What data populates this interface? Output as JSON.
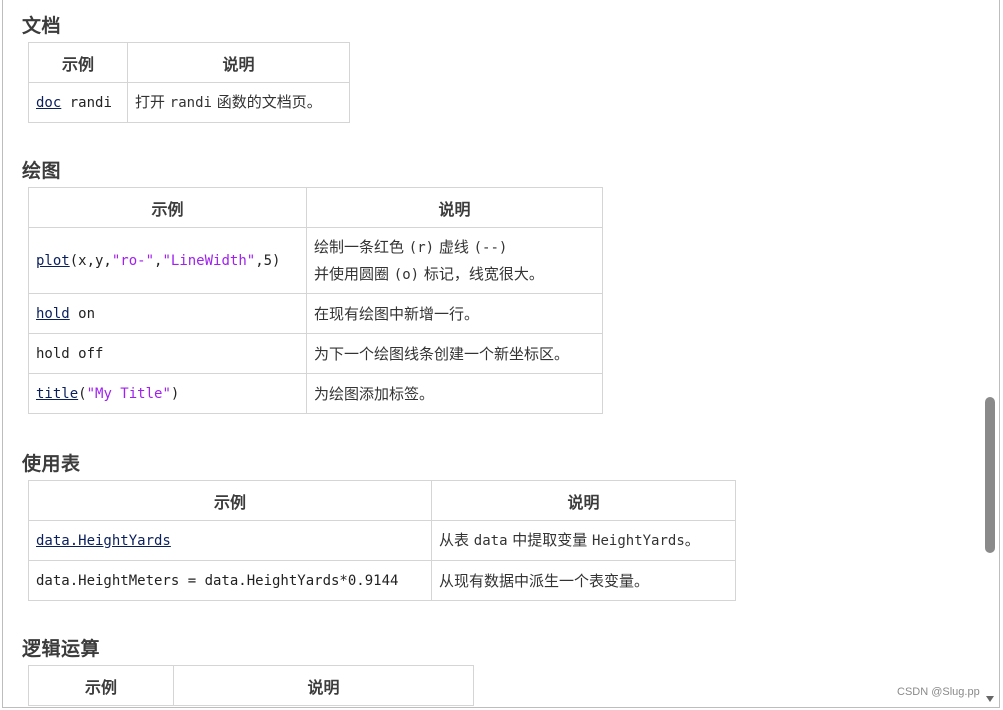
{
  "sections": {
    "doc": {
      "title": "文档",
      "headers": [
        "示例",
        "说明"
      ],
      "rows": [
        {
          "fn": "doc",
          "rest": " randi",
          "desc_pre": "打开 ",
          "desc_code": "randi",
          "desc_post": " 函数的文档页。"
        }
      ]
    },
    "plot": {
      "title": "绘图",
      "headers": [
        "示例",
        "说明"
      ],
      "row1": {
        "fn": "plot",
        "a": "(x,y,",
        "s1": "\"ro-\"",
        "b": ",",
        "s2": "\"LineWidth\"",
        "c": ",5)",
        "desc_line1_a": "绘制一条红色 ",
        "desc_line1_code": "(r)",
        "desc_line1_b": " 虚线 ",
        "desc_line1_code2": "(--)",
        "desc_line2_a": "并使用圆圈 ",
        "desc_line2_code": "(o)",
        "desc_line2_b": " 标记，线宽很大。"
      },
      "row2": {
        "fn": "hold",
        "rest": " on",
        "desc": "在现有绘图中新增一行。"
      },
      "row3": {
        "code": "hold off",
        "desc": "为下一个绘图线条创建一个新坐标区。"
      },
      "row4": {
        "fn": "title",
        "a": "(",
        "s": "\"My Title\"",
        "b": ")",
        "desc": "为绘图添加标签。"
      }
    },
    "table": {
      "title": "使用表",
      "headers": [
        "示例",
        "说明"
      ],
      "row1": {
        "fn": "data.HeightYards",
        "desc_a": "从表 ",
        "desc_code": "data",
        "desc_b": " 中提取变量 ",
        "desc_code2": "HeightYards",
        "desc_c": "。"
      },
      "row2": {
        "code": "data.HeightMeters = data.HeightYards*0.9144",
        "desc": "从现有数据中派生一个表变量。"
      }
    },
    "logic": {
      "title": "逻辑运算",
      "headers": [
        "示例",
        "说明"
      ]
    }
  },
  "watermark": "CSDN @Slug.pp"
}
